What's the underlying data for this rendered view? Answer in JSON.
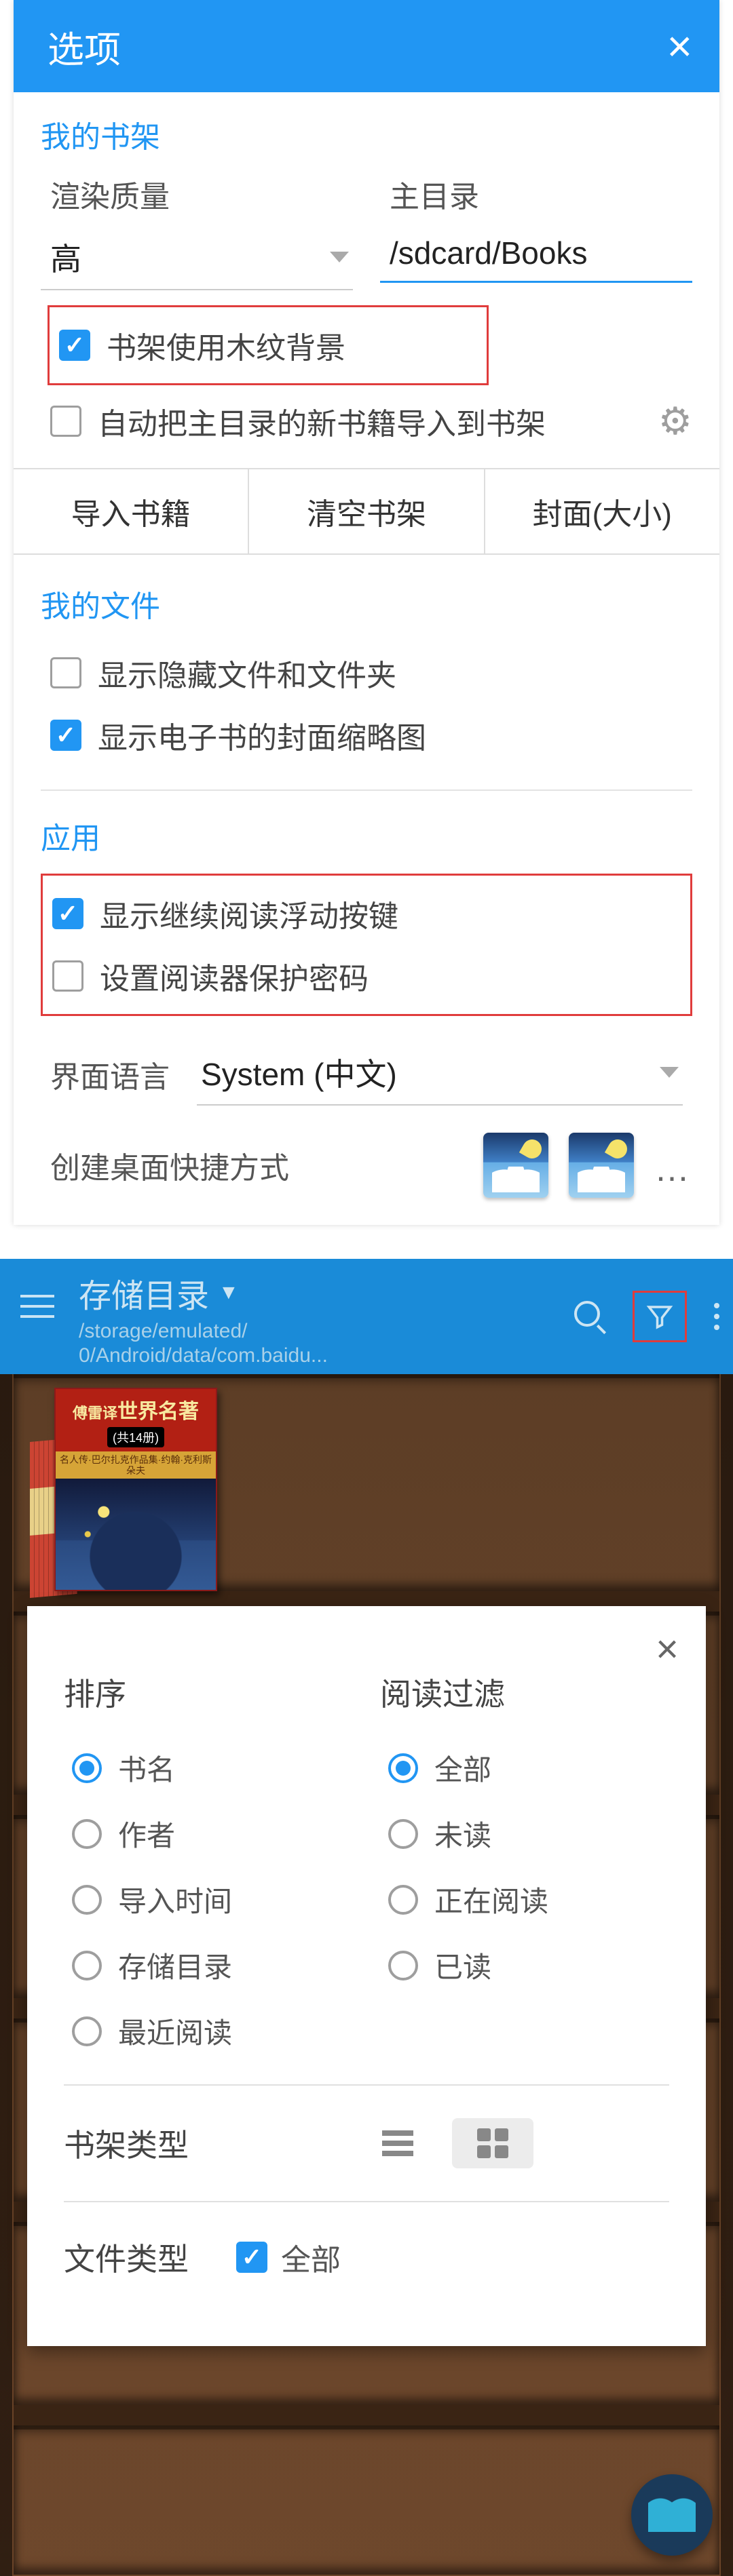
{
  "dialog": {
    "title": "选项",
    "sections": {
      "shelf": {
        "heading": "我的书架",
        "quality_label": "渲染质量",
        "quality_value": "高",
        "dir_label": "主目录",
        "dir_value": "/sdcard/Books",
        "chk_wood": "书架使用木纹背景",
        "chk_auto_import": "自动把主目录的新书籍导入到书架",
        "btn_import": "导入书籍",
        "btn_clear": "清空书架",
        "btn_cover": "封面(大小)"
      },
      "files": {
        "heading": "我的文件",
        "chk_hidden": "显示隐藏文件和文件夹",
        "chk_thumb": "显示电子书的封面缩略图"
      },
      "app": {
        "heading": "应用",
        "chk_float": "显示继续阅读浮动按键",
        "chk_pwd": "设置阅读器保护密码",
        "lang_label": "界面语言",
        "lang_value": "System (中文)",
        "shortcut_label": "创建桌面快捷方式"
      }
    }
  },
  "toolbar": {
    "title": "存储目录",
    "path_line1": "/storage/emulated/",
    "path_line2": "0/Android/data/com.baidu..."
  },
  "book": {
    "line1_prefix": "傅雷译",
    "line1_main": "世界名著",
    "line2": "(共14册)",
    "line3": "名人传·巴尔扎克作品集·约翰·克利斯朵夫"
  },
  "filter_dlg": {
    "sort_title": "排序",
    "sort": [
      "书名",
      "作者",
      "导入时间",
      "存储目录",
      "最近阅读"
    ],
    "read_title": "阅读过滤",
    "read": [
      "全部",
      "未读",
      "正在阅读",
      "已读"
    ],
    "shelf_type": "书架类型",
    "file_type": "文件类型",
    "file_all": "全部"
  }
}
